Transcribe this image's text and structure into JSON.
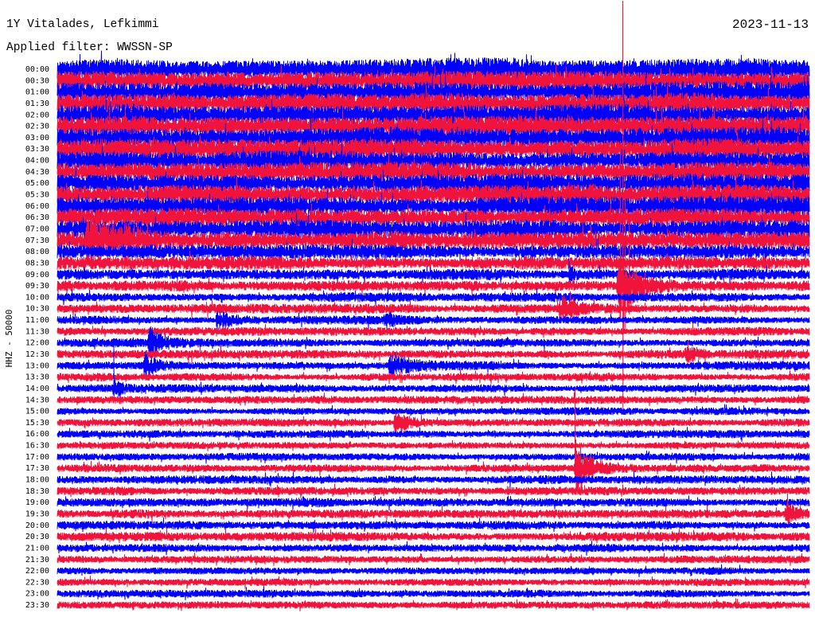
{
  "chart_data": {
    "type": "line",
    "title": "1Y Vitalades, Lefkimmi",
    "date": "2023-11-13",
    "subtitle": "Applied filter: WWSSN-SP",
    "ylabel": "HHZ - 50000",
    "xlim": [
      0,
      30
    ],
    "grid": false,
    "legend": "none",
    "rows": [
      {
        "label": "00:00",
        "color": "#0000ff",
        "amplitude": 0.84
      },
      {
        "label": "00:30",
        "color": "#f0143c",
        "amplitude": 0.84
      },
      {
        "label": "01:00",
        "color": "#0000ff",
        "amplitude": 0.84
      },
      {
        "label": "01:30",
        "color": "#f0143c",
        "amplitude": 0.84
      },
      {
        "label": "02:00",
        "color": "#0000ff",
        "amplitude": 0.84
      },
      {
        "label": "02:30",
        "color": "#f0143c",
        "amplitude": 0.84
      },
      {
        "label": "03:00",
        "color": "#0000ff",
        "amplitude": 0.84
      },
      {
        "label": "03:30",
        "color": "#f0143c",
        "amplitude": 0.84
      },
      {
        "label": "04:00",
        "color": "#0000ff",
        "amplitude": 0.78
      },
      {
        "label": "04:30",
        "color": "#f0143c",
        "amplitude": 0.78
      },
      {
        "label": "05:00",
        "color": "#0000ff",
        "amplitude": 0.78
      },
      {
        "label": "05:30",
        "color": "#f0143c",
        "amplitude": 0.78
      },
      {
        "label": "06:00",
        "color": "#0000ff",
        "amplitude": 0.76
      },
      {
        "label": "06:30",
        "color": "#f0143c",
        "amplitude": 0.76
      },
      {
        "label": "07:00",
        "color": "#0000ff",
        "amplitude": 0.74
      },
      {
        "label": "07:30",
        "color": "#f0143c",
        "amplitude": 0.74
      },
      {
        "label": "08:00",
        "color": "#0000ff",
        "amplitude": 0.58
      },
      {
        "label": "08:30",
        "color": "#f0143c",
        "amplitude": 0.56
      },
      {
        "label": "09:00",
        "color": "#0000ff",
        "amplitude": 0.46
      },
      {
        "label": "09:30",
        "color": "#f0143c",
        "amplitude": 0.45
      },
      {
        "label": "10:00",
        "color": "#0000ff",
        "amplitude": 0.37
      },
      {
        "label": "10:30",
        "color": "#f0143c",
        "amplitude": 0.36
      },
      {
        "label": "11:00",
        "color": "#0000ff",
        "amplitude": 0.35
      },
      {
        "label": "11:30",
        "color": "#f0143c",
        "amplitude": 0.35
      },
      {
        "label": "12:00",
        "color": "#0000ff",
        "amplitude": 0.35
      },
      {
        "label": "12:30",
        "color": "#f0143c",
        "amplitude": 0.35
      },
      {
        "label": "13:00",
        "color": "#0000ff",
        "amplitude": 0.34
      },
      {
        "label": "13:30",
        "color": "#f0143c",
        "amplitude": 0.33
      },
      {
        "label": "14:00",
        "color": "#0000ff",
        "amplitude": 0.31
      },
      {
        "label": "14:30",
        "color": "#f0143c",
        "amplitude": 0.31
      },
      {
        "label": "15:00",
        "color": "#0000ff",
        "amplitude": 0.3
      },
      {
        "label": "15:30",
        "color": "#f0143c",
        "amplitude": 0.31
      },
      {
        "label": "16:00",
        "color": "#0000ff",
        "amplitude": 0.31
      },
      {
        "label": "16:30",
        "color": "#f0143c",
        "amplitude": 0.31
      },
      {
        "label": "17:00",
        "color": "#0000ff",
        "amplitude": 0.31
      },
      {
        "label": "17:30",
        "color": "#f0143c",
        "amplitude": 0.32
      },
      {
        "label": "18:00",
        "color": "#0000ff",
        "amplitude": 0.33
      },
      {
        "label": "18:30",
        "color": "#f0143c",
        "amplitude": 0.35
      },
      {
        "label": "19:00",
        "color": "#0000ff",
        "amplitude": 0.37
      },
      {
        "label": "19:30",
        "color": "#f0143c",
        "amplitude": 0.37
      },
      {
        "label": "20:00",
        "color": "#0000ff",
        "amplitude": 0.36
      },
      {
        "label": "20:30",
        "color": "#f0143c",
        "amplitude": 0.35
      },
      {
        "label": "21:00",
        "color": "#0000ff",
        "amplitude": 0.32
      },
      {
        "label": "21:30",
        "color": "#f0143c",
        "amplitude": 0.32
      },
      {
        "label": "22:00",
        "color": "#0000ff",
        "amplitude": 0.31
      },
      {
        "label": "22:30",
        "color": "#f0143c",
        "amplitude": 0.31
      },
      {
        "label": "23:00",
        "color": "#0000ff",
        "amplitude": 0.31
      },
      {
        "label": "23:30",
        "color": "#f0143c",
        "amplitude": 0.32
      }
    ],
    "events": [
      {
        "row": "07:30",
        "minute": 1.1,
        "amplitude": 1.6,
        "duration": 3.5
      },
      {
        "row": "07:30",
        "minute": 2.6,
        "amplitude": 0.6,
        "duration": 1.8
      },
      {
        "row": "09:00",
        "minute": 20.4,
        "amplitude": 0.6,
        "duration": 0.4
      },
      {
        "row": "09:30",
        "minute": 22.3,
        "amplitude": 2.5,
        "duration": 2.0
      },
      {
        "row": "10:30",
        "minute": 20.0,
        "amplitude": 0.9,
        "duration": 1.6
      },
      {
        "row": "11:00",
        "minute": 6.3,
        "amplitude": 0.8,
        "duration": 1.4
      },
      {
        "row": "11:00",
        "minute": 13.0,
        "amplitude": 0.5,
        "duration": 0.8
      },
      {
        "row": "12:00",
        "minute": 3.6,
        "amplitude": 1.3,
        "duration": 1.0
      },
      {
        "row": "12:30",
        "minute": 25.0,
        "amplitude": 0.6,
        "duration": 1.2
      },
      {
        "row": "13:00",
        "minute": 3.4,
        "amplitude": 0.9,
        "duration": 1.0
      },
      {
        "row": "13:00",
        "minute": 13.2,
        "amplitude": 0.95,
        "duration": 1.8
      },
      {
        "row": "14:00",
        "minute": 2.2,
        "amplitude": 0.8,
        "duration": 0.5
      },
      {
        "row": "15:30",
        "minute": 13.4,
        "amplitude": 0.95,
        "duration": 1.3
      },
      {
        "row": "17:30",
        "minute": 20.6,
        "amplitude": 2.3,
        "duration": 1.4
      },
      {
        "row": "19:30",
        "minute": 29.0,
        "amplitude": 0.9,
        "duration": 0.9
      }
    ],
    "spikes": [
      {
        "row": "09:00",
        "minute": 20.4,
        "up": 1.4,
        "down": 1.0
      },
      {
        "row": "09:30",
        "minute": 22.45,
        "up": 12.0,
        "down": 3.0
      },
      {
        "row": "09:30",
        "minute": 22.55,
        "up": 25.0,
        "down": 10.9
      },
      {
        "row": "09:30",
        "minute": 22.65,
        "up": 9.0,
        "down": 4.0
      },
      {
        "row": "09:30",
        "minute": 22.8,
        "up": 6.0,
        "down": 2.5
      },
      {
        "row": "14:00",
        "minute": 2.25,
        "up": 4.0,
        "down": 0.8
      },
      {
        "row": "17:30",
        "minute": 20.65,
        "up": 7.0,
        "down": 0.8
      }
    ]
  }
}
